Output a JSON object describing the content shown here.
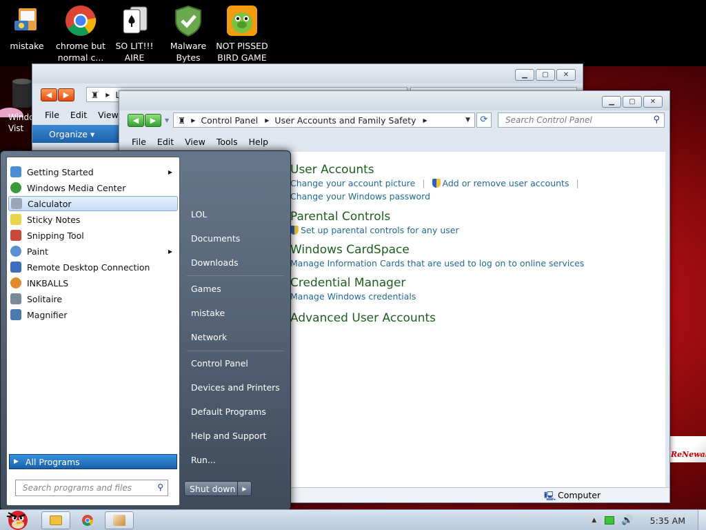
{
  "desktop": {
    "icons": [
      {
        "line1": "mistake",
        "line2": "",
        "icon": "computer-folder-icon"
      },
      {
        "line1": "chrome but",
        "line2": "normal c...",
        "icon": "chrome-icon"
      },
      {
        "line1": "SO LIT!!!",
        "line2": "AIRE",
        "icon": "solitaire-card-icon"
      },
      {
        "line1": "Malware",
        "line2": "Bytes",
        "icon": "shield-check-icon"
      },
      {
        "line1": "NOT PISSED",
        "line2": "BIRD GAME",
        "icon": "green-pig-game-icon"
      }
    ],
    "left_partial_label": "Windo\nVist",
    "renewal_text": "ReNewal"
  },
  "back_window": {
    "address_partial": "L",
    "menu": [
      "File",
      "Edit",
      "View"
    ],
    "organize_label": "Organize",
    "organize_arrow": "▾"
  },
  "cp_window": {
    "breadcrumb": [
      "Control Panel",
      "User Accounts and Family Safety"
    ],
    "search_placeholder": "Search Control Panel",
    "menu": [
      "File",
      "Edit",
      "View",
      "Tools",
      "Help"
    ],
    "status_location": "Computer",
    "tasks": [
      {
        "title": "User Accounts",
        "links": [
          "Change your account picture",
          "Add or remove user accounts",
          "Change your Windows password"
        ]
      },
      {
        "title": "Parental Controls",
        "links": [
          "Set up parental controls for any user"
        ]
      },
      {
        "title": "Windows CardSpace",
        "links": [
          "Manage Information Cards that are used to log on to online services"
        ]
      },
      {
        "title": "Credential Manager",
        "links": [
          "Manage Windows credentials"
        ]
      },
      {
        "title": "Advanced User Accounts",
        "links": []
      }
    ]
  },
  "start_menu": {
    "programs": [
      {
        "label": "Getting Started",
        "submenu": true,
        "color": "#4a8fd6"
      },
      {
        "label": "Windows Media Center",
        "submenu": false,
        "color": "#3a9a3a"
      },
      {
        "label": "Calculator",
        "submenu": false,
        "color": "#9aa7b6",
        "selected": true
      },
      {
        "label": "Sticky Notes",
        "submenu": false,
        "color": "#e6d64a"
      },
      {
        "label": "Snipping Tool",
        "submenu": false,
        "color": "#c94a3a"
      },
      {
        "label": "Paint",
        "submenu": true,
        "color": "#5a8fd0"
      },
      {
        "label": "Remote Desktop Connection",
        "submenu": false,
        "color": "#3a6fc0"
      },
      {
        "label": "INKBALLS",
        "submenu": false,
        "color": "#e08a2a"
      },
      {
        "label": "Solitaire",
        "submenu": false,
        "color": "#7a8a9a"
      },
      {
        "label": "Magnifier",
        "submenu": false,
        "color": "#4a7ab0"
      }
    ],
    "all_programs_label": "All Programs",
    "search_placeholder": "Search programs and files",
    "right_items": [
      "LOL",
      "Documents",
      "Downloads",
      "Games",
      "mistake",
      "Network",
      "Control Panel",
      "Devices and Printers",
      "Default Programs",
      "Help and Support",
      "Run..."
    ],
    "shutdown_label": "Shut down"
  },
  "taskbar": {
    "clock": "5:35 AM",
    "buttons": [
      "explorer-icon",
      "chrome-icon",
      "control-panel-icon"
    ]
  }
}
